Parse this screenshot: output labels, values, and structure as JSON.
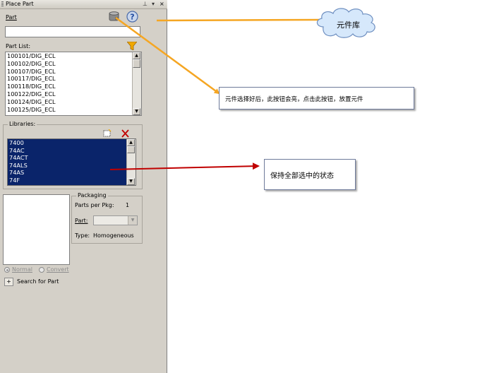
{
  "panel": {
    "title": "Place Part",
    "title_buttons": [
      "pin-icon",
      "dropdown-icon",
      "close-icon"
    ],
    "part_label": "Part",
    "part_value": "",
    "part_list_label": "Part List:",
    "part_list": [
      "100101/DIG_ECL",
      "100102/DIG_ECL",
      "100107/DIG_ECL",
      "100117/DIG_ECL",
      "100118/DIG_ECL",
      "100122/DIG_ECL",
      "100124/DIG_ECL",
      "100125/DIG_ECL"
    ],
    "libraries_label": "Libraries:",
    "libraries": [
      "7400",
      "74AC",
      "74ACT",
      "74ALS",
      "74AS",
      "74F"
    ],
    "packaging": {
      "title": "Packaging",
      "parts_per_pkg_label": "Parts per Pkg:",
      "parts_per_pkg_value": "1",
      "part_label": "Part:",
      "part_value": "",
      "type_label": "Type:",
      "type_value": "Homogeneous"
    },
    "radio_normal": "Normal",
    "radio_convert": "Convert",
    "search_button": "+",
    "search_label": "Search for Part"
  },
  "annotations": {
    "cloud_text": "元件库",
    "callout1": "元件选择好后，此按钮会亮，点击此按钮，放置元件",
    "callout2": "保持全部选中的状态"
  },
  "colors": {
    "panel_bg": "#d4d0c8",
    "selection_bg": "#0a246a",
    "orange_arrow": "#f5a623",
    "red_arrow": "#c00000",
    "filter_icon": "#f0a800"
  }
}
